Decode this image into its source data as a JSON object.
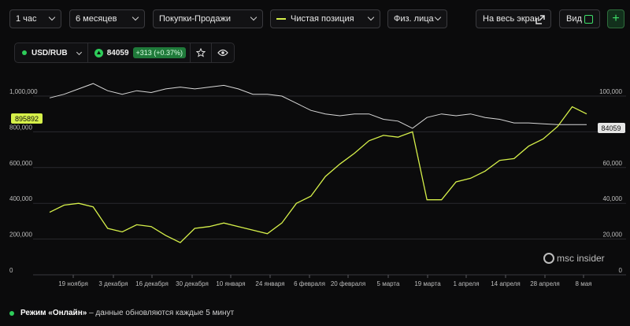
{
  "toolbar": {
    "interval": "1 час",
    "period": "6 месяцев",
    "metric": "Покупки-Продажи",
    "series": "Чистая позиция",
    "group": "Физ. лица",
    "fullscreen": "На весь экран",
    "view": "Вид",
    "add": "+"
  },
  "ticker": {
    "symbol": "USD/RUB",
    "price": "84059",
    "change": "+313 (+0.37%)"
  },
  "colors": {
    "net_position": "#d6f04a",
    "price": "#d8d8d8",
    "positive": "#2ecc5a"
  },
  "watermark": "msc insider",
  "footer": {
    "mode": "Режим «Онлайн»",
    "text": " – данные обновляются каждые 5 минут"
  },
  "chart_data": {
    "type": "line",
    "x_ticks": [
      "19 ноября",
      "3 декабря",
      "16 декабря",
      "30 декабря",
      "10 января",
      "24 января",
      "6 февраля",
      "20 февраля",
      "5 марта",
      "19 марта",
      "1 апреля",
      "14 апреля",
      "28 апреля",
      "8 мая"
    ],
    "left_axis": {
      "ticks": [
        "0",
        "200,000",
        "400,000",
        "600,000",
        "800,000",
        "1,000,000"
      ],
      "ylim": [
        0,
        1000000
      ]
    },
    "right_axis": {
      "ticks": [
        "0",
        "20,000",
        "40,000",
        "60,000",
        "80,000",
        "100,000"
      ],
      "ylim": [
        0,
        100000
      ]
    },
    "last_labels": {
      "net_position": "895892",
      "price": "84059"
    },
    "series": [
      {
        "name": "Чистая позиция",
        "axis": "left",
        "values": [
          350000,
          390000,
          400000,
          380000,
          260000,
          240000,
          280000,
          270000,
          220000,
          180000,
          260000,
          270000,
          290000,
          270000,
          250000,
          230000,
          290000,
          400000,
          440000,
          550000,
          620000,
          680000,
          750000,
          780000,
          770000,
          800000,
          420000,
          420000,
          520000,
          540000,
          580000,
          640000,
          650000,
          720000,
          760000,
          830000,
          940000,
          900000
        ]
      },
      {
        "name": "USD/RUB",
        "axis": "right",
        "values": [
          99000,
          101000,
          104000,
          107000,
          103000,
          101000,
          103000,
          102000,
          104000,
          105000,
          104000,
          105000,
          106000,
          104000,
          101000,
          101000,
          100000,
          96000,
          92000,
          90000,
          89000,
          90000,
          90000,
          87000,
          86000,
          82000,
          88000,
          90000,
          89000,
          90000,
          88000,
          87000,
          85000,
          85000,
          84500,
          84000,
          84059,
          84059
        ]
      }
    ]
  }
}
